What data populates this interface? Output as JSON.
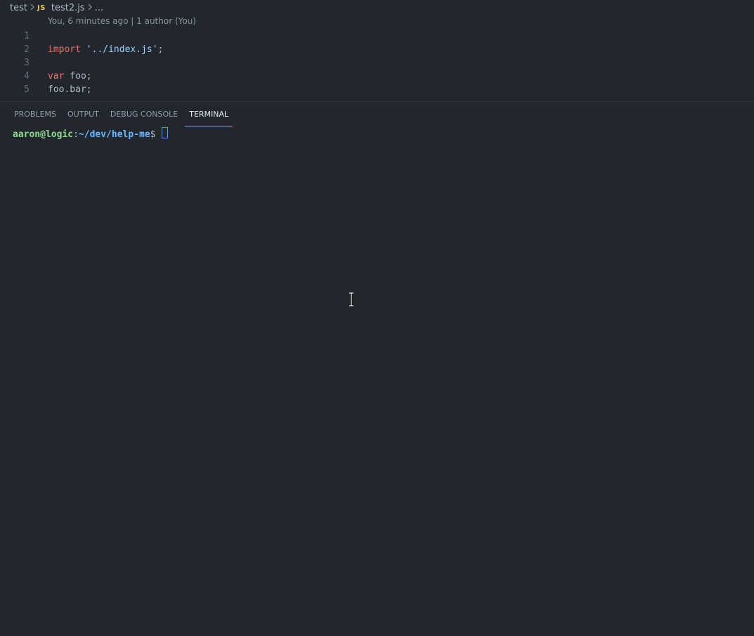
{
  "breadcrumb": {
    "folder": "test",
    "file_icon": "JS",
    "file": "test2.js",
    "more": "..."
  },
  "blame": "You, 6 minutes ago | 1 author (You)",
  "code": {
    "lines": [
      {
        "num": "1"
      },
      {
        "num": "2",
        "kw": "import",
        "str": "'../index.js'",
        "rest": ";"
      },
      {
        "num": "3"
      },
      {
        "num": "4",
        "kw": "var",
        "rest": " foo;"
      },
      {
        "num": "5",
        "plain": "foo.bar;"
      }
    ]
  },
  "panel": {
    "tabs": [
      {
        "label": "PROBLEMS"
      },
      {
        "label": "OUTPUT"
      },
      {
        "label": "DEBUG CONSOLE"
      },
      {
        "label": "TERMINAL",
        "active": true
      }
    ]
  },
  "terminal": {
    "user": "aaron@logic",
    "colon": ":",
    "path": "~/dev/help-me",
    "prompt": "$"
  },
  "colors": {
    "background": "#22272e",
    "accent_tab": "#ec775c",
    "keyword": "#f47067",
    "string": "#96d0ff",
    "terminal_user": "#8ddb8c",
    "terminal_path": "#6cb6ff"
  },
  "icons": [
    "chevron-right-icon",
    "js-file-icon",
    "text-cursor-icon"
  ]
}
